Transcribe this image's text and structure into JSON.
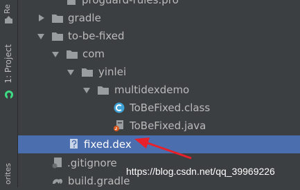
{
  "tool_stripe": {
    "top_tab_label": "Re",
    "project_tab_label": "1: Project",
    "favorites_tab_label": "orites"
  },
  "tree": {
    "rows": [
      {
        "label": "proguard-rules.pro",
        "icon": "file-icon"
      },
      {
        "label": "gradle",
        "icon": "folder-icon",
        "expanded": false
      },
      {
        "label": "to-be-fixed",
        "icon": "folder-icon",
        "expanded": true
      },
      {
        "label": "com",
        "icon": "folder-icon",
        "expanded": true
      },
      {
        "label": "yinlei",
        "icon": "folder-icon",
        "expanded": true
      },
      {
        "label": "multidexdemo",
        "icon": "folder-icon",
        "expanded": true
      },
      {
        "label": "ToBeFixed.class",
        "icon": "class-icon"
      },
      {
        "label": "ToBeFixed.java",
        "icon": "java-file-icon"
      },
      {
        "label": "fixed.dex",
        "icon": "unknown-file-icon",
        "selected": true
      },
      {
        "label": ".gitignore",
        "icon": "gitignore-icon"
      },
      {
        "label": "build.gradle",
        "icon": "gradle-icon"
      }
    ]
  },
  "annotation": {
    "arrow_color": "#e8202a",
    "watermark": "https://blog.csdn.net/qq_39969226"
  },
  "colors": {
    "panel_bg": "#3c3f41",
    "selection": "#4b6eaf",
    "text": "#bbbbbb",
    "folder": "#9a9da0",
    "class_icon": "#3fa2d6",
    "java_badge": "#d9591f"
  }
}
